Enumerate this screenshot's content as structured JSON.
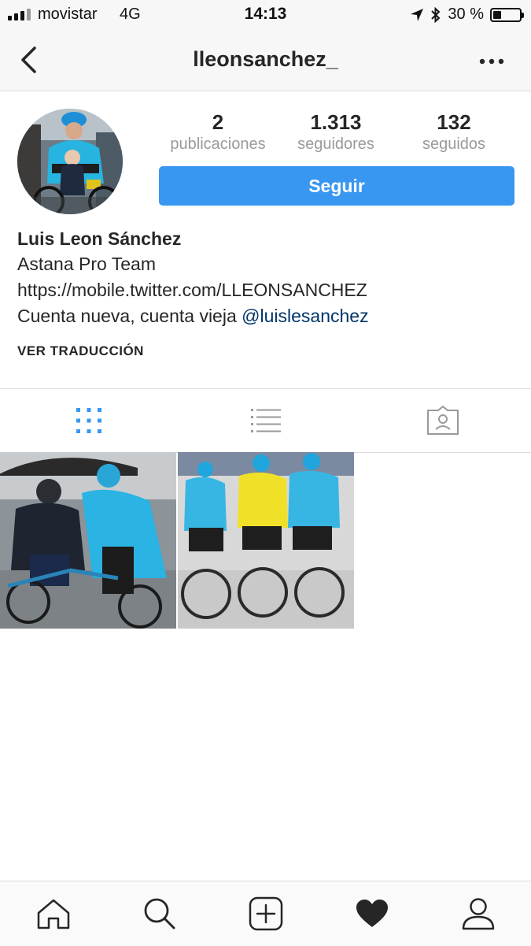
{
  "status_bar": {
    "carrier": "movistar",
    "network": "4G",
    "time": "14:13",
    "battery": "30 %",
    "battery_level": 0.3,
    "icons": [
      "signal-icon",
      "location-arrow-icon",
      "bluetooth-icon",
      "battery-icon"
    ]
  },
  "nav": {
    "username": "lleonsanchez_",
    "icons": [
      "back-chevron-icon",
      "more-dots-icon"
    ]
  },
  "profile": {
    "stats": [
      {
        "value": "2",
        "label": "publicaciones"
      },
      {
        "value": "1.313",
        "label": "seguidores"
      },
      {
        "value": "132",
        "label": "seguidos"
      }
    ],
    "follow_button": "Seguir",
    "name": "Luis Leon Sánchez",
    "bio_lines": [
      "Astana Pro Team",
      "https://mobile.twitter.com/LLEONSANCHEZ"
    ],
    "bio_last_prefix": "Cuenta nueva, cuenta vieja ",
    "bio_mention": "@luislesanchez",
    "translate": "VER TRADUCCIÓN"
  },
  "tabs": {
    "icons": [
      "grid-icon",
      "list-icon",
      "tagged-icon"
    ],
    "active": "grid-icon"
  },
  "posts": {
    "count": 2,
    "items": [
      "post-photo-rain-cyclists",
      "post-photo-peloton"
    ]
  },
  "bottom_nav": {
    "icons": [
      "home-icon",
      "search-icon",
      "new-post-icon",
      "activity-heart-icon",
      "profile-icon"
    ]
  },
  "colors": {
    "accent": "#3897f0",
    "link": "#003569",
    "text": "#262626",
    "muted": "#9a9a9a"
  }
}
